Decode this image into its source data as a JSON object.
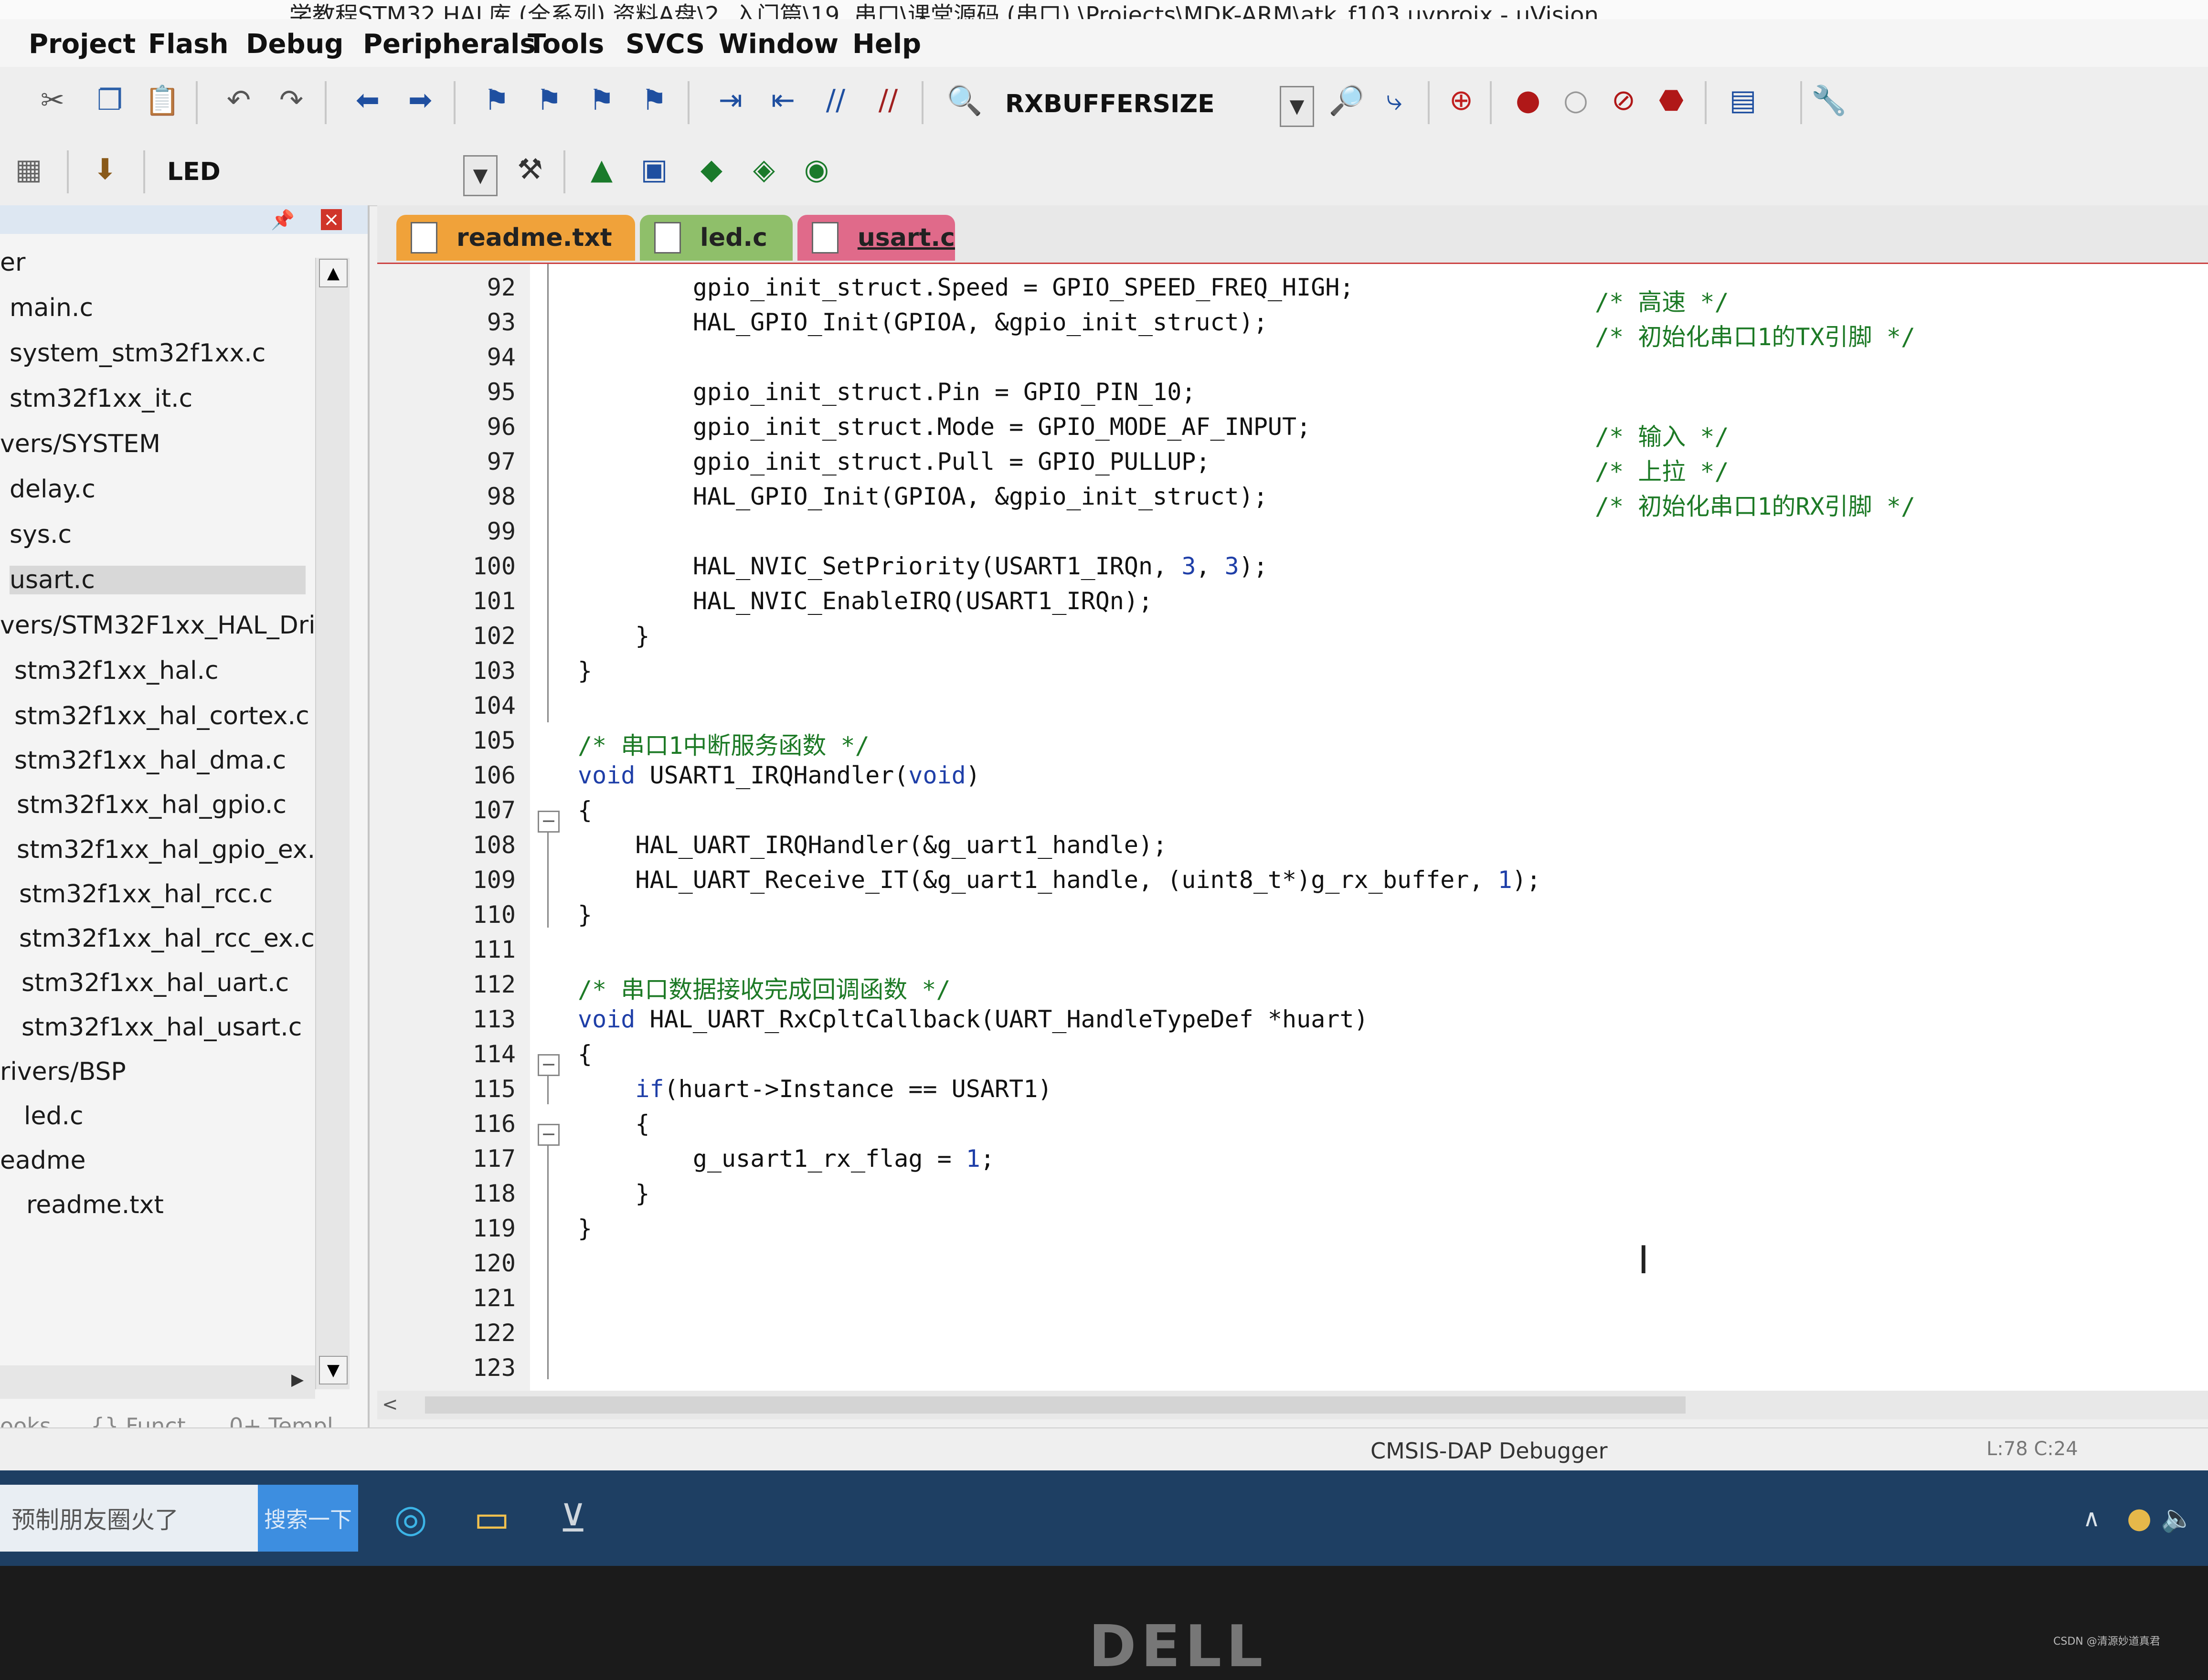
{
  "window": {
    "title": "...学教程STM32 HAL库 (全系列) 资料A盘\\2. 入门篇\\19, 串口\\课堂源码 (串口) \\Projects\\MDK-ARM\\atk_f103.uvprojx - µVision"
  },
  "menu": [
    "Project",
    "Flash",
    "Debug",
    "Peripherals",
    "Tools",
    "SVCS",
    "Window",
    "Help"
  ],
  "toolbar": {
    "find_text": "RXBUFFERSIZE",
    "target": "LED"
  },
  "project": {
    "items": [
      "er",
      "main.c",
      "system_stm32f1xx.c",
      "stm32f1xx_it.c",
      "vers/SYSTEM",
      "delay.c",
      "sys.c",
      "usart.c",
      "vers/STM32F1xx_HAL_Driv",
      "stm32f1xx_hal.c",
      "stm32f1xx_hal_cortex.c",
      "stm32f1xx_hal_dma.c",
      "stm32f1xx_hal_gpio.c",
      "stm32f1xx_hal_gpio_ex.c",
      "stm32f1xx_hal_rcc.c",
      "stm32f1xx_hal_rcc_ex.c",
      "stm32f1xx_hal_uart.c",
      "stm32f1xx_hal_usart.c",
      "rivers/BSP",
      "led.c",
      "eadme",
      "readme.txt"
    ],
    "selected": "usart.c",
    "bottom_tabs": [
      "ooks",
      "{} Funct...",
      "0+ Templ..."
    ]
  },
  "tabs": [
    {
      "label": "readme.txt",
      "color": "#f0a23a"
    },
    {
      "label": "led.c",
      "color": "#8fbf6a"
    },
    {
      "label": "usart.c",
      "color": "#e06a8a"
    }
  ],
  "code": {
    "line_numbers": [
      "92",
      "93",
      "94",
      "95",
      "96",
      "97",
      "98",
      "99",
      "100",
      "101",
      "102",
      "103",
      "104",
      "105",
      "106",
      "107",
      "108",
      "109",
      "110",
      "111",
      "112",
      "113",
      "114",
      "115",
      "116",
      "117",
      "118",
      "119",
      "120",
      "121",
      "122",
      "123"
    ],
    "lines": {
      "l92": "        gpio_init_struct.Speed = GPIO_SPEED_FREQ_HIGH;",
      "l92c": "/* 高速 */",
      "l93": "        HAL_GPIO_Init(GPIOA, &gpio_init_struct);",
      "l93c": "/* 初始化串口1的TX引脚 */",
      "l95": "        gpio_init_struct.Pin = GPIO_PIN_10;",
      "l96": "        gpio_init_struct.Mode = GPIO_MODE_AF_INPUT;",
      "l96c": "/* 输入 */",
      "l97": "        gpio_init_struct.Pull = GPIO_PULLUP;",
      "l97c": "/* 上拉 */",
      "l98": "        HAL_GPIO_Init(GPIOA, &gpio_init_struct);",
      "l98c": "/* 初始化串口1的RX引脚 */",
      "l100a": "        HAL_NVIC_SetPriority(USART1_IRQn, ",
      "l100b": "3",
      "l100c": ", ",
      "l100d": "3",
      "l100e": ");",
      "l101": "        HAL_NVIC_EnableIRQ(USART1_IRQn);",
      "l102": "    }",
      "l103": "}",
      "l105": "/* 串口1中断服务函数 */",
      "l106a": "void",
      "l106b": " USART1_IRQHandler(",
      "l106c": "void",
      "l106d": ")",
      "l107": "{",
      "l108": "    HAL_UART_IRQHandler(&g_uart1_handle);",
      "l109a": "    HAL_UART_Receive_IT(&g_uart1_handle, (uint8_t*)g_rx_buffer, ",
      "l109b": "1",
      "l109c": ");",
      "l110": "}",
      "l112": "/* 串口数据接收完成回调函数 */",
      "l113a": "void",
      "l113b": " HAL_UART_RxCpltCallback(UART_HandleTypeDef *huart)",
      "l114": "{",
      "l115a": "    if",
      "l115b": "(huart->Instance == USART1)",
      "l116": "    {",
      "l117a": "        g_usart1_rx_flag = ",
      "l117b": "1",
      "l117c": ";",
      "l118": "    }",
      "l119": "}"
    }
  },
  "status": {
    "debugger": "CMSIS-DAP Debugger",
    "position": "L:78 C:24"
  },
  "taskbar": {
    "search_text": "预制朋友圈火了",
    "search_button": "搜索一下"
  },
  "bezel": {
    "brand": "DELL"
  },
  "watermark": "CSDN @清源妙道真君"
}
